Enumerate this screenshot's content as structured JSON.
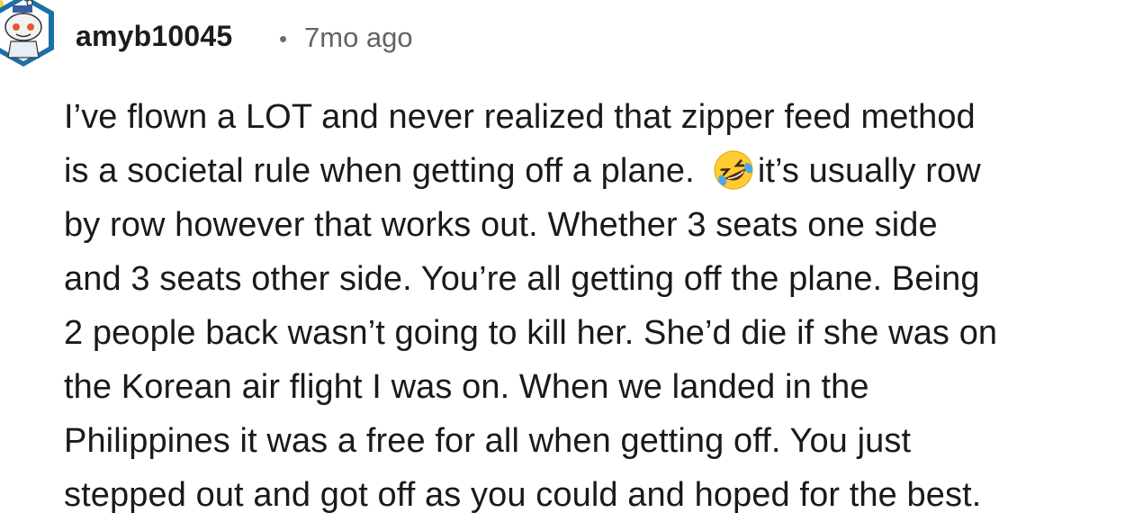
{
  "comment": {
    "author": "amyb10045",
    "separator": "•",
    "time_ago": "7mo ago",
    "avatar_icon": "reddit-snoo-avatar-icon",
    "emoji_icon": "rolling-on-floor-laughing-emoji",
    "lines": [
      {
        "text": "I’ve flown a LOT and never realized that zipper feed method"
      },
      {
        "text_before": "is a societal rule when getting off a plane.",
        "text_after": "it’s usually row"
      },
      {
        "text": "by row however that works out. Whether 3 seats one side"
      },
      {
        "text": "and 3 seats other side. You’re all getting off the plane. Being"
      },
      {
        "text": "2 people back wasn’t going to kill her. She’d die if she was on"
      },
      {
        "text": "the Korean air flight I was on. When we landed in the"
      },
      {
        "text": "Philippines it was a free for all when getting off. You just"
      },
      {
        "text": "stepped out and got off as you could and hoped for the best."
      }
    ]
  },
  "colors": {
    "text": "#1a1a1b",
    "meta": "#5f6467",
    "avatar_ring": "#1e6fa8",
    "emoji_yellow": "#ffcc33"
  }
}
